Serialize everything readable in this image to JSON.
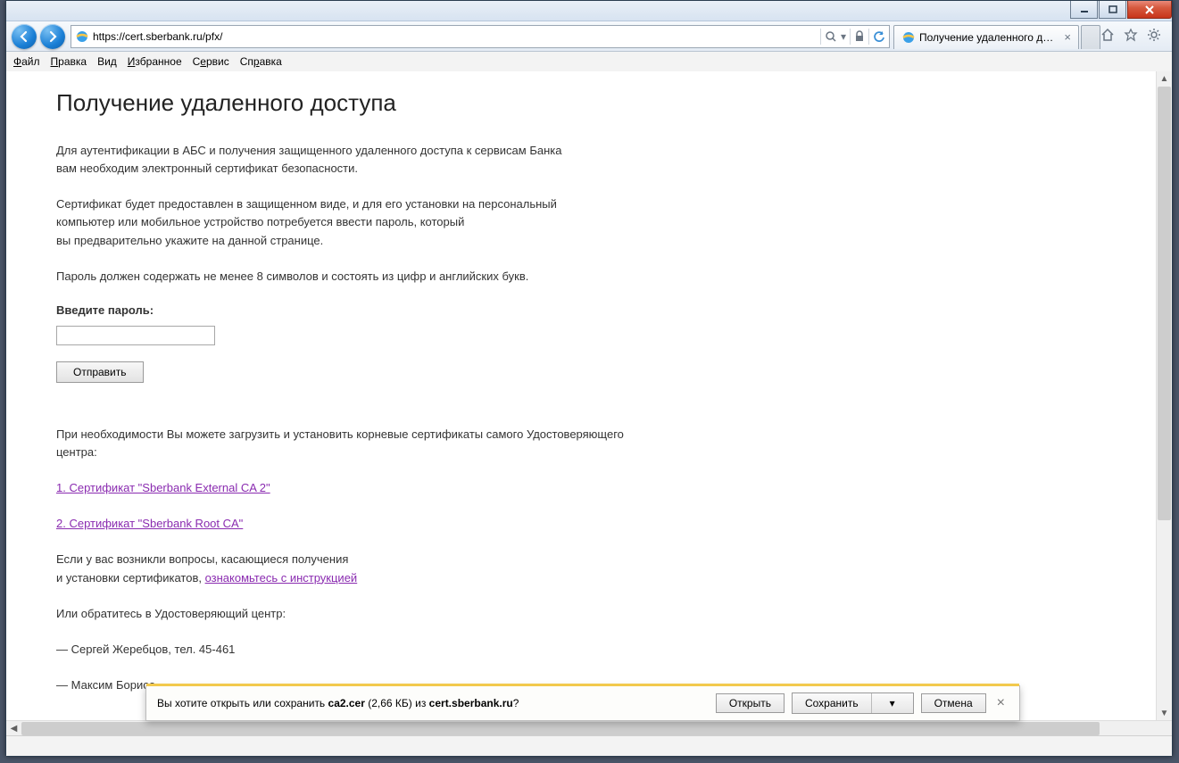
{
  "window": {
    "min": "—",
    "max": "❐",
    "close": "✕"
  },
  "nav": {
    "url": "https://cert.sberbank.ru/pfx/",
    "tab_title": "Получение удаленного до...",
    "search_icon": "search",
    "refresh_icon": "refresh",
    "lock_icon": "lock"
  },
  "menu": {
    "file": "Файл",
    "edit": "Правка",
    "view": "Вид",
    "favorites": "Избранное",
    "tools": "Сервис",
    "help": "Справка"
  },
  "page": {
    "title": "Получение удаленного доступа",
    "p1": "Для аутентификации в АБС и получения защищенного удаленного доступа к сервисам Банка",
    "p1b": "вам необходим электронный сертификат безопасности.",
    "p2": "Сертификат будет предоставлен в защищенном виде, и для его установки на персональный",
    "p2b": "компьютер или мобильное устройство потребуется ввести пароль, который",
    "p2c": "вы предварительно укажите на данной странице.",
    "p3": "Пароль должен содержать не менее 8 символов и состоять из цифр и английских букв.",
    "label": "Введите пароль:",
    "submit": "Отправить",
    "p4": "При необходимости Вы можете загрузить и установить корневые сертификаты самого Удостоверяющего",
    "p4b": "центра:",
    "link1": "1. Сертификат \"Sberbank External CA 2\"",
    "link2": "2. Сертификат \"Sberbank Root CA\"",
    "p5": "Если у вас возникли вопросы, касающиеся получения",
    "p5b": "и установки сертификатов, ",
    "link3": "ознакомьтесь с инструкцией",
    "p6": "Или обратитесь в Удостоверяющий центр:",
    "c1": "— Сергей Жеребцов, тел. 45-461",
    "c2": "— Максим Борисо"
  },
  "download": {
    "prefix": "Вы хотите открыть или сохранить ",
    "file": "ca2.cer",
    "size": " (2,66 КБ) из ",
    "host": "cert.sberbank.ru",
    "q": "?",
    "open": "Открыть",
    "save": "Сохранить",
    "cancel": "Отмена"
  }
}
